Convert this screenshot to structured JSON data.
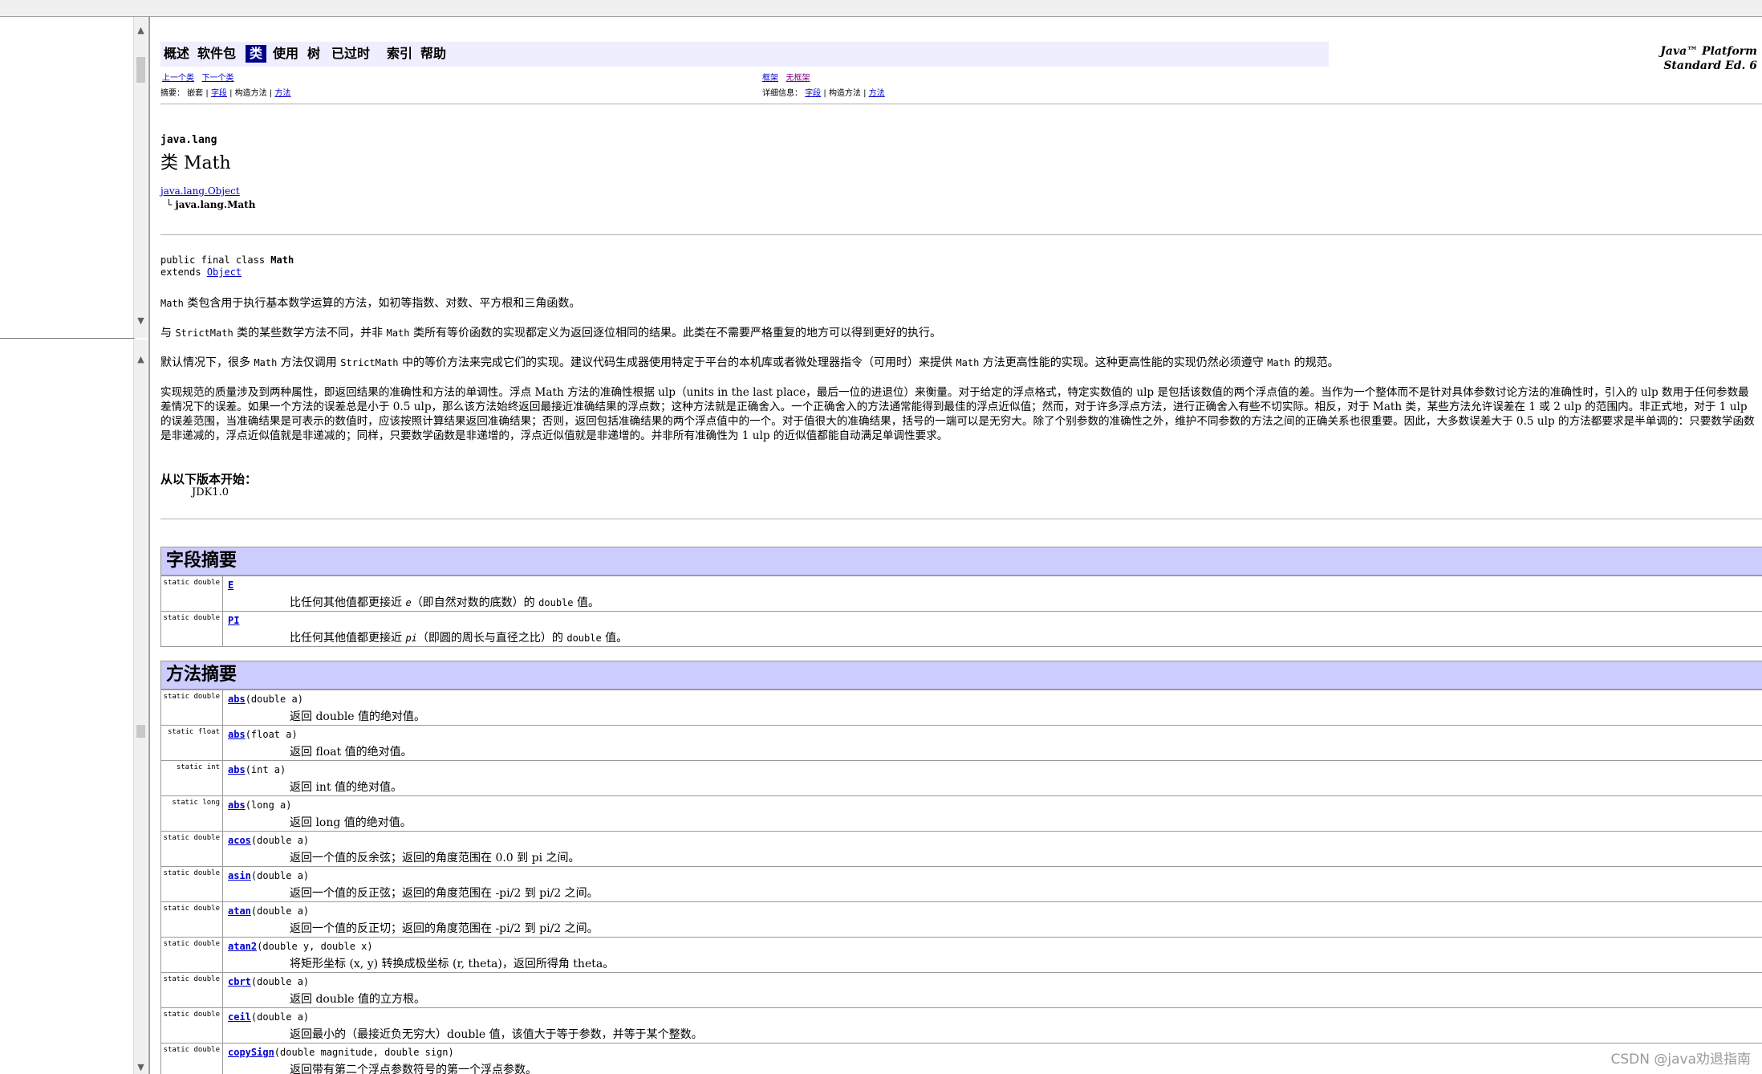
{
  "nav": {
    "items": [
      "概述",
      "软件包",
      "类",
      "使用",
      "树",
      "已过时",
      "索引",
      "帮助"
    ],
    "current_index": 2,
    "platform_line1": "Java™ Platform",
    "platform_line2": "Standard Ed. 6",
    "prev_class": "上一个类",
    "next_class": "下一个类",
    "frames": "框架",
    "no_frames": "无框架",
    "summary_prefix": "摘要：",
    "summary_nested": "嵌套",
    "summary_field": "字段",
    "summary_constr": "构造方法",
    "summary_method": "方法",
    "detail_prefix": "详细信息：",
    "detail_field": "字段",
    "detail_constr": "构造方法",
    "detail_method": "方法",
    "sep": "|"
  },
  "header": {
    "package": "java.lang",
    "title": "类 Math",
    "parent": "java.lang.Object",
    "tree_glyph": "└",
    "child": "java.lang.Math",
    "decl_prefix": "public final class",
    "decl_name": "Math",
    "extends_kw": "extends",
    "extends_link": "Object"
  },
  "desc": {
    "p1_code": "Math",
    "p1_text": " 类包含用于执行基本数学运算的方法，如初等指数、对数、平方根和三角函数。",
    "p2_a": "与 ",
    "p2_code1": "StrictMath",
    "p2_b": " 类的某些数学方法不同，并非 ",
    "p2_code2": "Math",
    "p2_c": " 类所有等价函数的实现都定义为返回逐位相同的结果。此类在不需要严格重复的地方可以得到更好的执行。",
    "p3_a": "默认情况下，很多 ",
    "p3_code1": "Math",
    "p3_b": " 方法仅调用 ",
    "p3_code2": "StrictMath",
    "p3_c": " 中的等价方法来完成它们的实现。建议代码生成器使用特定于平台的本机库或者微处理器指令（可用时）来提供 ",
    "p3_code3": "Math",
    "p3_d": " 方法更高性能的实现。这种更高性能的实现仍然必须遵守 ",
    "p3_code4": "Math",
    "p3_e": " 的规范。",
    "p4": "实现规范的质量涉及到两种属性，即返回结果的准确性和方法的单调性。浮点 Math 方法的准确性根据 ulp（units in the last place，最后一位的进退位）来衡量。对于给定的浮点格式，特定实数值的 ulp 是包括该数值的两个浮点值的差。当作为一个整体而不是针对具体参数讨论方法的准确性时，引入的 ulp 数用于任何参数最差情况下的误差。如果一个方法的误差总是小于 0.5 ulp，那么该方法始终返回最接近准确结果的浮点数；这种方法就是正确舍入。一个正确舍入的方法通常能得到最佳的浮点近似值；然而，对于许多浮点方法，进行正确舍入有些不切实际。相反，对于 Math 类，某些方法允许误差在 1 或 2 ulp 的范围内。非正式地，对于 1 ulp 的误差范围，当准确结果是可表示的数值时，应该按照计算结果返回准确结果；否则，返回包括准确结果的两个浮点值中的一个。对于值很大的准确结果，括号的一端可以是无穷大。除了个别参数的准确性之外，维护不同参数的方法之间的正确关系也很重要。因此，大多数误差大于 0.5 ulp 的方法都要求是半单调的：只要数学函数是非递减的，浮点近似值就是非递减的；同样，只要数学函数是非递增的，浮点近似值就是非递增的。并非所有准确性为 1 ulp 的近似值都能自动满足单调性要求。"
  },
  "since": {
    "heading": "从以下版本开始：",
    "value": "JDK1.0"
  },
  "fields": {
    "heading": "字段摘要",
    "rows": [
      {
        "mod": "static double",
        "name": "E",
        "d1": "比任何其他值都更接近 ",
        "d_it": "e",
        "d2": "（即自然对数的底数）的 ",
        "d_code": "double",
        "d3": " 值。"
      },
      {
        "mod": "static double",
        "name": "PI",
        "d1": "比任何其他值都更接近 ",
        "d_it": "pi",
        "d2": "（即圆的周长与直径之比）的 ",
        "d_code": "double",
        "d3": " 值。"
      }
    ]
  },
  "methods": {
    "heading": "方法摘要",
    "rows": [
      {
        "mod": "static double",
        "name": "abs",
        "args": "(double a)",
        "desc": "返回 double 值的绝对值。"
      },
      {
        "mod": "static float",
        "name": "abs",
        "args": "(float a)",
        "desc": "返回 float 值的绝对值。"
      },
      {
        "mod": "static int",
        "name": "abs",
        "args": "(int a)",
        "desc": "返回 int 值的绝对值。"
      },
      {
        "mod": "static long",
        "name": "abs",
        "args": "(long a)",
        "desc": "返回 long 值的绝对值。"
      },
      {
        "mod": "static double",
        "name": "acos",
        "args": "(double a)",
        "desc": "返回一个值的反余弦；返回的角度范围在 0.0 到 pi 之间。"
      },
      {
        "mod": "static double",
        "name": "asin",
        "args": "(double a)",
        "desc": "返回一个值的反正弦；返回的角度范围在 -pi/2 到 pi/2 之间。"
      },
      {
        "mod": "static double",
        "name": "atan",
        "args": "(double a)",
        "desc": "返回一个值的反正切；返回的角度范围在 -pi/2 到 pi/2 之间。"
      },
      {
        "mod": "static double",
        "name": "atan2",
        "args": "(double y, double x)",
        "desc": "将矩形坐标 (x, y) 转换成极坐标 (r, theta)，返回所得角 theta。"
      },
      {
        "mod": "static double",
        "name": "cbrt",
        "args": "(double a)",
        "desc": "返回 double 值的立方根。"
      },
      {
        "mod": "static double",
        "name": "ceil",
        "args": "(double a)",
        "desc": "返回最小的（最接近负无穷大）double 值，该值大于等于参数，并等于某个整数。"
      },
      {
        "mod": "static double",
        "name": "copySign",
        "args": "(double magnitude, double sign)",
        "desc": "返回带有第二个浮点参数符号的第一个浮点参数。"
      }
    ]
  },
  "watermark": "CSDN @java劝退指南"
}
